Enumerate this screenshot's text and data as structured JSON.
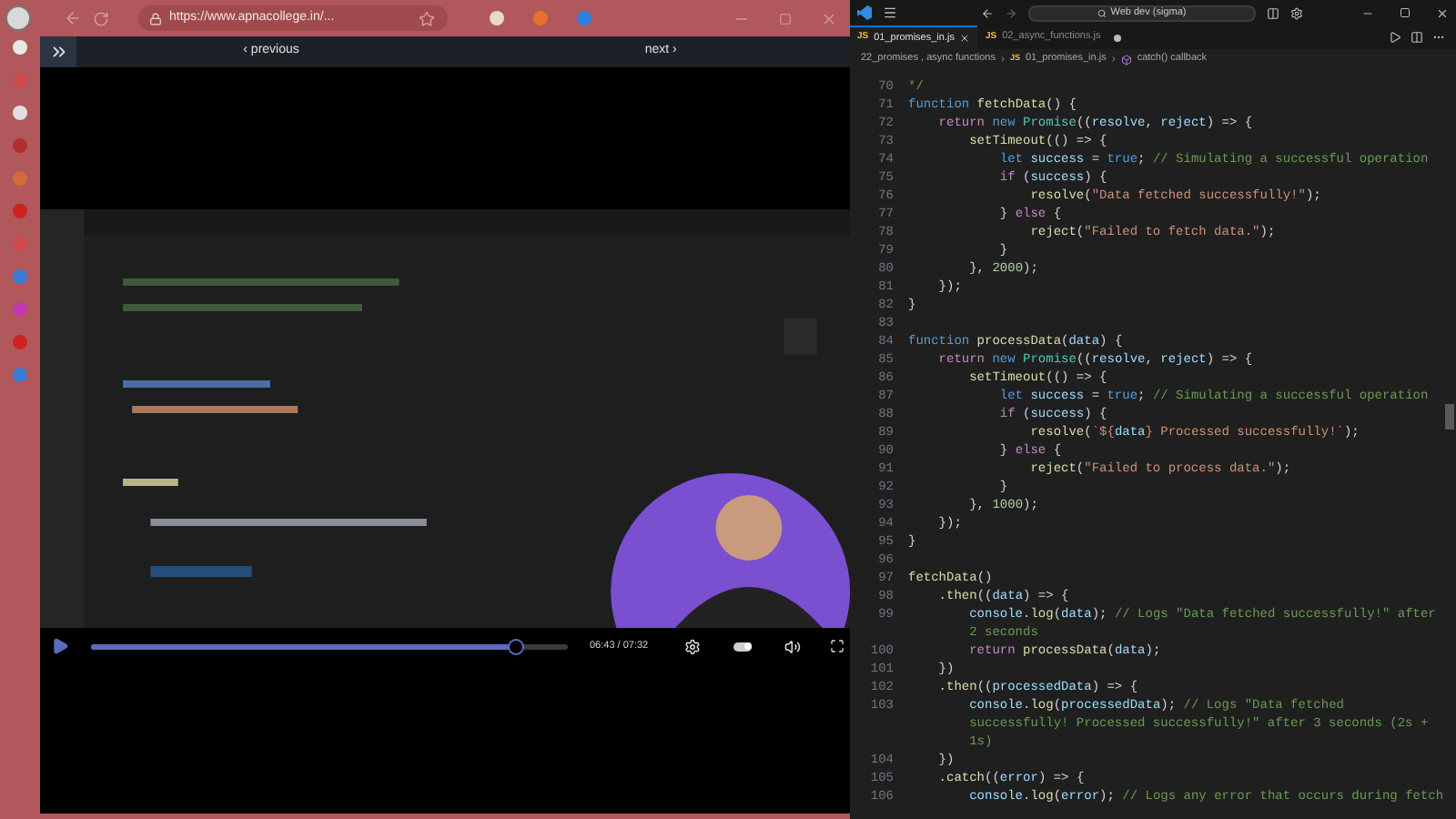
{
  "browser": {
    "url": "https://www.apnacollege.in/..."
  },
  "lesson_nav": {
    "previous": "‹ previous",
    "next": "next ›"
  },
  "video": {
    "time": "06:43 / 07:32",
    "progress": {
      "level": 0.89
    },
    "autoplay": {
      "on": true
    }
  },
  "editor": {
    "search": "Web dev (sigma)",
    "tabs": [
      {
        "icon_text": "JS",
        "label": "01_promises_in.js",
        "selected": true,
        "modified": false
      },
      {
        "icon_text": "JS",
        "label": "02_async_functions.js",
        "selected": false,
        "modified": true
      }
    ],
    "breadcrumb": [
      {
        "kind": "folder",
        "label": "22_promises , async functions"
      },
      {
        "kind": "file",
        "separator": "›",
        "icon_text": "JS",
        "label": "01_promises_in.js"
      },
      {
        "kind": "symbol",
        "separator": "›",
        "label": "catch() callback"
      }
    ],
    "lines": [
      {
        "number": "70",
        "segments": [
          {
            "kind": "cmt",
            "text": "*/"
          }
        ]
      },
      {
        "number": "71",
        "segments": [
          {
            "kind": "kw",
            "text": "function"
          },
          {
            "kind": "fn",
            "text": " fetchData"
          },
          {
            "kind": "plain",
            "text": "() {"
          }
        ]
      },
      {
        "number": "72",
        "segments": [
          {
            "kind": "ctl",
            "text": "    return"
          },
          {
            "kind": "kw",
            "text": " new"
          },
          {
            "kind": "cls",
            "text": " Promise"
          },
          {
            "kind": "plain",
            "text": "(("
          },
          {
            "kind": "var",
            "text": "resolve"
          },
          {
            "kind": "plain",
            "text": ", "
          },
          {
            "kind": "var",
            "text": "reject"
          },
          {
            "kind": "plain",
            "text": ") => {"
          }
        ]
      },
      {
        "number": "73",
        "segments": [
          {
            "kind": "fn",
            "text": "        setTimeout"
          },
          {
            "kind": "plain",
            "text": "(() => {"
          }
        ]
      },
      {
        "number": "74",
        "segments": [
          {
            "kind": "kw",
            "text": "            let"
          },
          {
            "kind": "var",
            "text": " success"
          },
          {
            "kind": "plain",
            "text": " = "
          },
          {
            "kind": "kw",
            "text": "true"
          },
          {
            "kind": "plain",
            "text": "; "
          },
          {
            "kind": "cmt",
            "text": "// Simulating a successful operation"
          }
        ]
      },
      {
        "number": "75",
        "segments": [
          {
            "kind": "ctl",
            "text": "            if"
          },
          {
            "kind": "plain",
            "text": " ("
          },
          {
            "kind": "var",
            "text": "success"
          },
          {
            "kind": "plain",
            "text": ") {"
          }
        ]
      },
      {
        "number": "76",
        "segments": [
          {
            "kind": "fn",
            "text": "                resolve"
          },
          {
            "kind": "plain",
            "text": "("
          },
          {
            "kind": "str",
            "text": "\"Data fetched successfully!\""
          },
          {
            "kind": "plain",
            "text": ");"
          }
        ]
      },
      {
        "number": "77",
        "segments": [
          {
            "kind": "plain",
            "text": "            } "
          },
          {
            "kind": "ctl",
            "text": "else"
          },
          {
            "kind": "plain",
            "text": " {"
          }
        ]
      },
      {
        "number": "78",
        "segments": [
          {
            "kind": "fn",
            "text": "                reject"
          },
          {
            "kind": "plain",
            "text": "("
          },
          {
            "kind": "str",
            "text": "\"Failed to fetch data.\""
          },
          {
            "kind": "plain",
            "text": ");"
          }
        ]
      },
      {
        "number": "79",
        "segments": [
          {
            "kind": "plain",
            "text": "            }"
          }
        ]
      },
      {
        "number": "80",
        "segments": [
          {
            "kind": "plain",
            "text": "        }, "
          },
          {
            "kind": "num",
            "text": "2000"
          },
          {
            "kind": "plain",
            "text": ");"
          }
        ]
      },
      {
        "number": "81",
        "segments": [
          {
            "kind": "plain",
            "text": "    });"
          }
        ]
      },
      {
        "number": "82",
        "segments": [
          {
            "kind": "plain",
            "text": "}"
          }
        ]
      },
      {
        "number": "83"
      },
      {
        "number": "84",
        "segments": [
          {
            "kind": "kw",
            "text": "function"
          },
          {
            "kind": "fn",
            "text": " processData"
          },
          {
            "kind": "plain",
            "text": "("
          },
          {
            "kind": "var",
            "text": "data"
          },
          {
            "kind": "plain",
            "text": ") {"
          }
        ]
      },
      {
        "number": "85",
        "segments": [
          {
            "kind": "ctl",
            "text": "    return"
          },
          {
            "kind": "kw",
            "text": " new"
          },
          {
            "kind": "cls",
            "text": " Promise"
          },
          {
            "kind": "plain",
            "text": "(("
          },
          {
            "kind": "var",
            "text": "resolve"
          },
          {
            "kind": "plain",
            "text": ", "
          },
          {
            "kind": "var",
            "text": "reject"
          },
          {
            "kind": "plain",
            "text": ") => {"
          }
        ]
      },
      {
        "number": "86",
        "segments": [
          {
            "kind": "fn",
            "text": "        setTimeout"
          },
          {
            "kind": "plain",
            "text": "(() => {"
          }
        ]
      },
      {
        "number": "87",
        "segments": [
          {
            "kind": "kw",
            "text": "            let"
          },
          {
            "kind": "var",
            "text": " success"
          },
          {
            "kind": "plain",
            "text": " = "
          },
          {
            "kind": "kw",
            "text": "true"
          },
          {
            "kind": "plain",
            "text": "; "
          },
          {
            "kind": "cmt",
            "text": "// Simulating a successful operation"
          }
        ]
      },
      {
        "number": "88",
        "segments": [
          {
            "kind": "ctl",
            "text": "            if"
          },
          {
            "kind": "plain",
            "text": " ("
          },
          {
            "kind": "var",
            "text": "success"
          },
          {
            "kind": "plain",
            "text": ") {"
          }
        ]
      },
      {
        "number": "89",
        "segments": [
          {
            "kind": "fn",
            "text": "                resolve"
          },
          {
            "kind": "plain",
            "text": "("
          },
          {
            "kind": "str",
            "text": "`${"
          },
          {
            "kind": "var",
            "text": "data"
          },
          {
            "kind": "str",
            "text": "} Processed successfully!`"
          },
          {
            "kind": "plain",
            "text": ");"
          }
        ]
      },
      {
        "number": "90",
        "segments": [
          {
            "kind": "plain",
            "text": "            } "
          },
          {
            "kind": "ctl",
            "text": "else"
          },
          {
            "kind": "plain",
            "text": " {"
          }
        ]
      },
      {
        "number": "91",
        "segments": [
          {
            "kind": "fn",
            "text": "                reject"
          },
          {
            "kind": "plain",
            "text": "("
          },
          {
            "kind": "str",
            "text": "\"Failed to process data.\""
          },
          {
            "kind": "plain",
            "text": ");"
          }
        ]
      },
      {
        "number": "92",
        "segments": [
          {
            "kind": "plain",
            "text": "            }"
          }
        ]
      },
      {
        "number": "93",
        "segments": [
          {
            "kind": "plain",
            "text": "        }, "
          },
          {
            "kind": "num",
            "text": "1000"
          },
          {
            "kind": "plain",
            "text": ");"
          }
        ]
      },
      {
        "number": "94",
        "segments": [
          {
            "kind": "plain",
            "text": "    });"
          }
        ]
      },
      {
        "number": "95",
        "segments": [
          {
            "kind": "plain",
            "text": "}"
          }
        ]
      },
      {
        "number": "96"
      },
      {
        "number": "97",
        "segments": [
          {
            "kind": "fn",
            "text": "fetchData"
          },
          {
            "kind": "plain",
            "text": "()"
          }
        ]
      },
      {
        "number": "98",
        "segments": [
          {
            "kind": "fn",
            "text": "    .then"
          },
          {
            "kind": "plain",
            "text": "(("
          },
          {
            "kind": "var",
            "text": "data"
          },
          {
            "kind": "plain",
            "text": ") => {"
          }
        ]
      },
      {
        "number": "99",
        "segments": [
          {
            "kind": "var",
            "text": "        console"
          },
          {
            "kind": "plain",
            "text": "."
          },
          {
            "kind": "fn",
            "text": "log"
          },
          {
            "kind": "plain",
            "text": "("
          },
          {
            "kind": "var",
            "text": "data"
          },
          {
            "kind": "plain",
            "text": "); "
          },
          {
            "kind": "cmt",
            "text": "// Logs \"Data fetched successfully!\" after"
          }
        ]
      },
      {
        "segments": [
          {
            "kind": "cmt",
            "text": "        2 seconds"
          }
        ]
      },
      {
        "number": "100",
        "segments": [
          {
            "kind": "ctl",
            "text": "        return"
          },
          {
            "kind": "fn",
            "text": " processData"
          },
          {
            "kind": "plain",
            "text": "("
          },
          {
            "kind": "var",
            "text": "data"
          },
          {
            "kind": "plain",
            "text": ");"
          }
        ]
      },
      {
        "number": "101",
        "segments": [
          {
            "kind": "plain",
            "text": "    })"
          }
        ]
      },
      {
        "number": "102",
        "segments": [
          {
            "kind": "fn",
            "text": "    .then"
          },
          {
            "kind": "plain",
            "text": "(("
          },
          {
            "kind": "var",
            "text": "processedData"
          },
          {
            "kind": "plain",
            "text": ") => {"
          }
        ]
      },
      {
        "number": "103",
        "segments": [
          {
            "kind": "var",
            "text": "        console"
          },
          {
            "kind": "plain",
            "text": "."
          },
          {
            "kind": "fn",
            "text": "log"
          },
          {
            "kind": "plain",
            "text": "("
          },
          {
            "kind": "var",
            "text": "processedData"
          },
          {
            "kind": "plain",
            "text": "); "
          },
          {
            "kind": "cmt",
            "text": "// Logs \"Data fetched"
          }
        ]
      },
      {
        "segments": [
          {
            "kind": "cmt",
            "text": "        successfully! Processed successfully!\" after 3 seconds (2s +"
          }
        ]
      },
      {
        "segments": [
          {
            "kind": "cmt",
            "text": "        1s)"
          }
        ]
      },
      {
        "number": "104",
        "segments": [
          {
            "kind": "plain",
            "text": "    })"
          }
        ]
      },
      {
        "number": "105",
        "segments": [
          {
            "kind": "fn",
            "text": "    .catch"
          },
          {
            "kind": "plain",
            "text": "(("
          },
          {
            "kind": "var",
            "text": "error"
          },
          {
            "kind": "plain",
            "text": ") => {"
          }
        ]
      },
      {
        "number": "106",
        "segments": [
          {
            "kind": "var",
            "text": "        console"
          },
          {
            "kind": "plain",
            "text": "."
          },
          {
            "kind": "fn",
            "text": "log"
          },
          {
            "kind": "plain",
            "text": "("
          },
          {
            "kind": "var",
            "text": "error"
          },
          {
            "kind": "plain",
            "text": "); "
          },
          {
            "kind": "cmt",
            "text": "// Logs any error that occurs during fetch"
          }
        ]
      }
    ]
  }
}
